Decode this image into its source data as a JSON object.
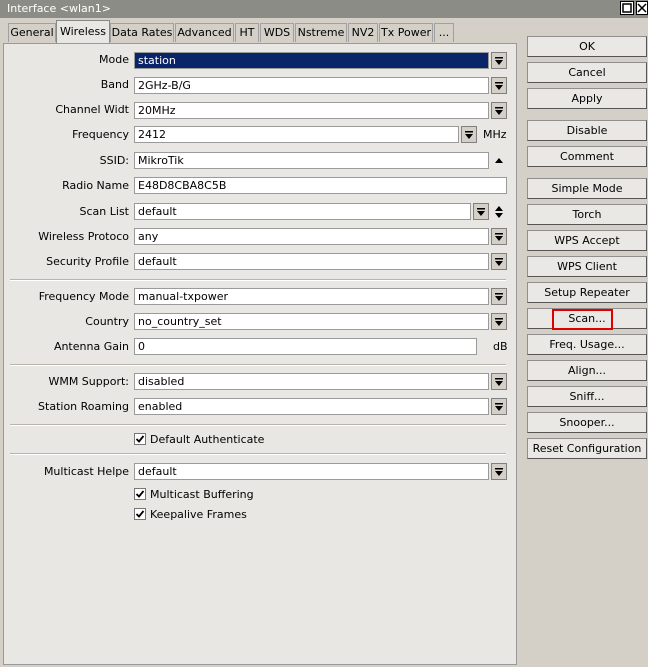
{
  "window": {
    "title": "Interface <wlan1>"
  },
  "tabs": [
    "General",
    "Wireless",
    "Data Rates",
    "Advanced",
    "HT",
    "WDS",
    "Nstreme",
    "NV2",
    "Tx Power",
    "..."
  ],
  "fields": {
    "mode": {
      "label": "Mode",
      "value": "station"
    },
    "band": {
      "label": "Band",
      "value": "2GHz-B/G"
    },
    "channel_width": {
      "label": "Channel Widt",
      "value": "20MHz"
    },
    "frequency": {
      "label": "Frequency",
      "value": "2412",
      "unit": "MHz"
    },
    "ssid": {
      "label": "SSID:",
      "value": "MikroTik"
    },
    "radio_name": {
      "label": "Radio Name",
      "value": "E48D8CBA8C5B"
    },
    "scan_list": {
      "label": "Scan List",
      "value": "default"
    },
    "wireless_protocol": {
      "label": "Wireless Protoco",
      "value": "any"
    },
    "security_profile": {
      "label": "Security Profile",
      "value": "default"
    },
    "frequency_mode": {
      "label": "Frequency Mode",
      "value": "manual-txpower"
    },
    "country": {
      "label": "Country",
      "value": "no_country_set"
    },
    "antenna_gain": {
      "label": "Antenna Gain",
      "value": "0",
      "unit": "dB"
    },
    "wmm_support": {
      "label": "WMM Support:",
      "value": "disabled"
    },
    "station_roaming": {
      "label": "Station Roaming",
      "value": "enabled"
    },
    "multicast_helper": {
      "label": "Multicast Helpe",
      "value": "default"
    }
  },
  "checkboxes": {
    "default_authenticate": {
      "label": "Default Authenticate",
      "checked": true
    },
    "multicast_buffering": {
      "label": "Multicast Buffering",
      "checked": true
    },
    "keepalive_frames": {
      "label": "Keepalive Frames",
      "checked": true
    }
  },
  "buttons": [
    "OK",
    "Cancel",
    "Apply",
    "Disable",
    "Comment",
    "Simple Mode",
    "Torch",
    "WPS Accept",
    "WPS Client",
    "Setup Repeater",
    "Scan...",
    "Freq. Usage...",
    "Align...",
    "Sniff...",
    "Snooper...",
    "Reset Configuration"
  ],
  "colors": {
    "title_bar": "#8c8c86",
    "selection": "#0a246a",
    "highlight_box": "#e00000"
  }
}
